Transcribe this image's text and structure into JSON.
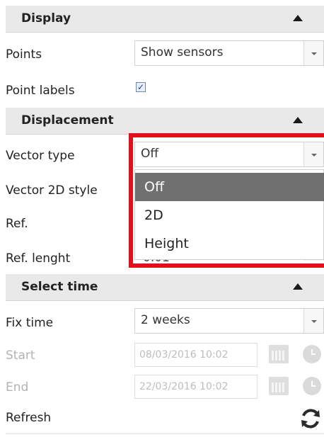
{
  "sections": {
    "display": {
      "title": "Display"
    },
    "displacement": {
      "title": "Displacement"
    },
    "select_time": {
      "title": "Select time"
    }
  },
  "display": {
    "points_label": "Points",
    "points_value": "Show sensors",
    "point_labels_label": "Point labels",
    "point_labels_checked": true,
    "checkmark": "✓"
  },
  "displacement": {
    "vector_type_label": "Vector type",
    "vector_type_value": "Off",
    "vector_2d_style_label": "Vector 2D style",
    "ref_label": "Ref.",
    "ref_length_label": "Ref. lenght",
    "ref_length_value_partial": "0.01",
    "dropdown_options": [
      "Off",
      "2D",
      "Height"
    ],
    "dropdown_selected": "Off"
  },
  "select_time": {
    "fix_time_label": "Fix time",
    "fix_time_value": "2 weeks",
    "start_label": "Start",
    "start_value": "08/03/2016 10:02",
    "end_label": "End",
    "end_value": "22/03/2016 10:02",
    "refresh_label": "Refresh"
  },
  "icons": {
    "collapse": "triangle-up-icon",
    "dropdown": "chevron-down-icon",
    "calendar": "calendar-icon",
    "clock": "clock-icon",
    "refresh": "refresh-icon"
  },
  "colors": {
    "highlight": "#e0101c",
    "selected_option_bg": "#707070",
    "header_bg": "#e9e9e9"
  }
}
